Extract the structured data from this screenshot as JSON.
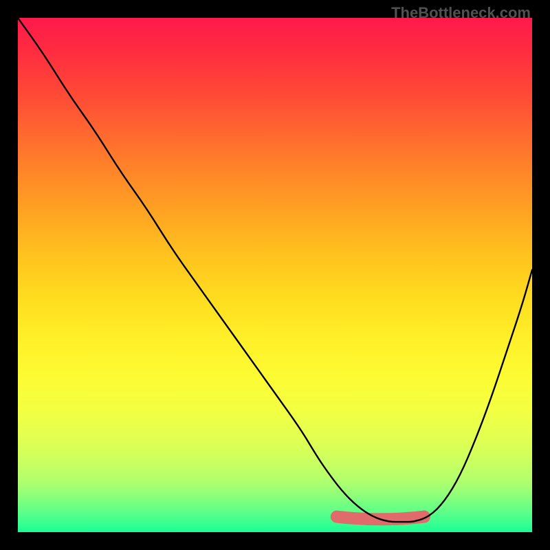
{
  "watermark": "TheBottleneck.com",
  "chart_data": {
    "type": "line",
    "title": "",
    "xlabel": "",
    "ylabel": "",
    "xlim": [
      0,
      100
    ],
    "ylim": [
      0,
      100
    ],
    "grid": false,
    "series": [
      {
        "name": "curve",
        "color": "#000000",
        "x": [
          0,
          5,
          10,
          15,
          20,
          25,
          30,
          35,
          40,
          45,
          50,
          55,
          58,
          60,
          63,
          66,
          69,
          72,
          75,
          77,
          80,
          83,
          86,
          89,
          92,
          95,
          98,
          100
        ],
        "y": [
          100,
          93,
          85,
          78,
          70,
          63,
          55,
          48,
          41,
          34,
          27,
          20,
          15,
          12,
          8,
          5,
          3,
          2,
          2,
          2,
          3,
          6,
          11,
          18,
          26,
          35,
          44,
          51
        ]
      }
    ],
    "highlight_band": {
      "color": "#e16a6a",
      "x_start": 62,
      "x_end": 79,
      "y": 2,
      "dot_x": 79,
      "dot_y": 3
    },
    "background_gradient": {
      "top": "#ff194b",
      "bottom": "#18ff96"
    }
  }
}
